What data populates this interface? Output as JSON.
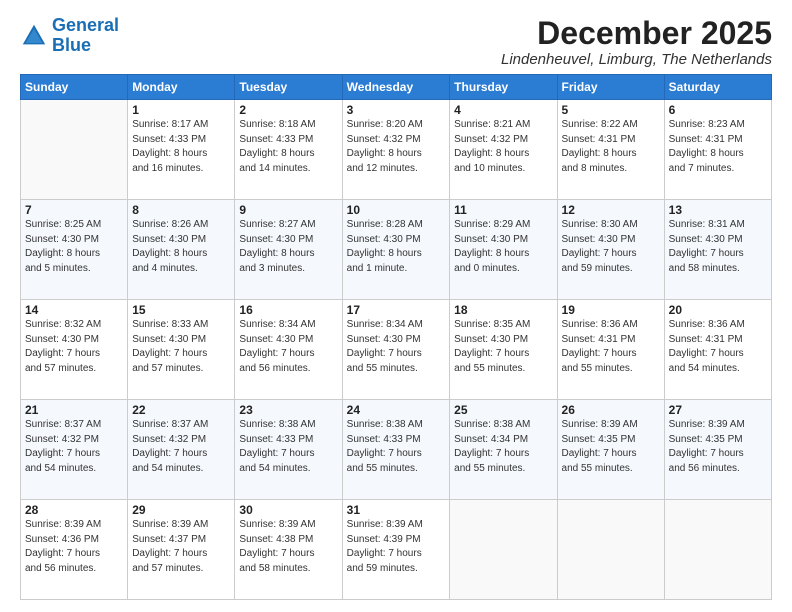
{
  "logo": {
    "line1": "General",
    "line2": "Blue"
  },
  "title": "December 2025",
  "location": "Lindenheuvel, Limburg, The Netherlands",
  "weekdays": [
    "Sunday",
    "Monday",
    "Tuesday",
    "Wednesday",
    "Thursday",
    "Friday",
    "Saturday"
  ],
  "weeks": [
    [
      {
        "day": "",
        "info": ""
      },
      {
        "day": "1",
        "info": "Sunrise: 8:17 AM\nSunset: 4:33 PM\nDaylight: 8 hours\nand 16 minutes."
      },
      {
        "day": "2",
        "info": "Sunrise: 8:18 AM\nSunset: 4:33 PM\nDaylight: 8 hours\nand 14 minutes."
      },
      {
        "day": "3",
        "info": "Sunrise: 8:20 AM\nSunset: 4:32 PM\nDaylight: 8 hours\nand 12 minutes."
      },
      {
        "day": "4",
        "info": "Sunrise: 8:21 AM\nSunset: 4:32 PM\nDaylight: 8 hours\nand 10 minutes."
      },
      {
        "day": "5",
        "info": "Sunrise: 8:22 AM\nSunset: 4:31 PM\nDaylight: 8 hours\nand 8 minutes."
      },
      {
        "day": "6",
        "info": "Sunrise: 8:23 AM\nSunset: 4:31 PM\nDaylight: 8 hours\nand 7 minutes."
      }
    ],
    [
      {
        "day": "7",
        "info": "Sunrise: 8:25 AM\nSunset: 4:30 PM\nDaylight: 8 hours\nand 5 minutes."
      },
      {
        "day": "8",
        "info": "Sunrise: 8:26 AM\nSunset: 4:30 PM\nDaylight: 8 hours\nand 4 minutes."
      },
      {
        "day": "9",
        "info": "Sunrise: 8:27 AM\nSunset: 4:30 PM\nDaylight: 8 hours\nand 3 minutes."
      },
      {
        "day": "10",
        "info": "Sunrise: 8:28 AM\nSunset: 4:30 PM\nDaylight: 8 hours\nand 1 minute."
      },
      {
        "day": "11",
        "info": "Sunrise: 8:29 AM\nSunset: 4:30 PM\nDaylight: 8 hours\nand 0 minutes."
      },
      {
        "day": "12",
        "info": "Sunrise: 8:30 AM\nSunset: 4:30 PM\nDaylight: 7 hours\nand 59 minutes."
      },
      {
        "day": "13",
        "info": "Sunrise: 8:31 AM\nSunset: 4:30 PM\nDaylight: 7 hours\nand 58 minutes."
      }
    ],
    [
      {
        "day": "14",
        "info": "Sunrise: 8:32 AM\nSunset: 4:30 PM\nDaylight: 7 hours\nand 57 minutes."
      },
      {
        "day": "15",
        "info": "Sunrise: 8:33 AM\nSunset: 4:30 PM\nDaylight: 7 hours\nand 57 minutes."
      },
      {
        "day": "16",
        "info": "Sunrise: 8:34 AM\nSunset: 4:30 PM\nDaylight: 7 hours\nand 56 minutes."
      },
      {
        "day": "17",
        "info": "Sunrise: 8:34 AM\nSunset: 4:30 PM\nDaylight: 7 hours\nand 55 minutes."
      },
      {
        "day": "18",
        "info": "Sunrise: 8:35 AM\nSunset: 4:30 PM\nDaylight: 7 hours\nand 55 minutes."
      },
      {
        "day": "19",
        "info": "Sunrise: 8:36 AM\nSunset: 4:31 PM\nDaylight: 7 hours\nand 55 minutes."
      },
      {
        "day": "20",
        "info": "Sunrise: 8:36 AM\nSunset: 4:31 PM\nDaylight: 7 hours\nand 54 minutes."
      }
    ],
    [
      {
        "day": "21",
        "info": "Sunrise: 8:37 AM\nSunset: 4:32 PM\nDaylight: 7 hours\nand 54 minutes."
      },
      {
        "day": "22",
        "info": "Sunrise: 8:37 AM\nSunset: 4:32 PM\nDaylight: 7 hours\nand 54 minutes."
      },
      {
        "day": "23",
        "info": "Sunrise: 8:38 AM\nSunset: 4:33 PM\nDaylight: 7 hours\nand 54 minutes."
      },
      {
        "day": "24",
        "info": "Sunrise: 8:38 AM\nSunset: 4:33 PM\nDaylight: 7 hours\nand 55 minutes."
      },
      {
        "day": "25",
        "info": "Sunrise: 8:38 AM\nSunset: 4:34 PM\nDaylight: 7 hours\nand 55 minutes."
      },
      {
        "day": "26",
        "info": "Sunrise: 8:39 AM\nSunset: 4:35 PM\nDaylight: 7 hours\nand 55 minutes."
      },
      {
        "day": "27",
        "info": "Sunrise: 8:39 AM\nSunset: 4:35 PM\nDaylight: 7 hours\nand 56 minutes."
      }
    ],
    [
      {
        "day": "28",
        "info": "Sunrise: 8:39 AM\nSunset: 4:36 PM\nDaylight: 7 hours\nand 56 minutes."
      },
      {
        "day": "29",
        "info": "Sunrise: 8:39 AM\nSunset: 4:37 PM\nDaylight: 7 hours\nand 57 minutes."
      },
      {
        "day": "30",
        "info": "Sunrise: 8:39 AM\nSunset: 4:38 PM\nDaylight: 7 hours\nand 58 minutes."
      },
      {
        "day": "31",
        "info": "Sunrise: 8:39 AM\nSunset: 4:39 PM\nDaylight: 7 hours\nand 59 minutes."
      },
      {
        "day": "",
        "info": ""
      },
      {
        "day": "",
        "info": ""
      },
      {
        "day": "",
        "info": ""
      }
    ]
  ]
}
